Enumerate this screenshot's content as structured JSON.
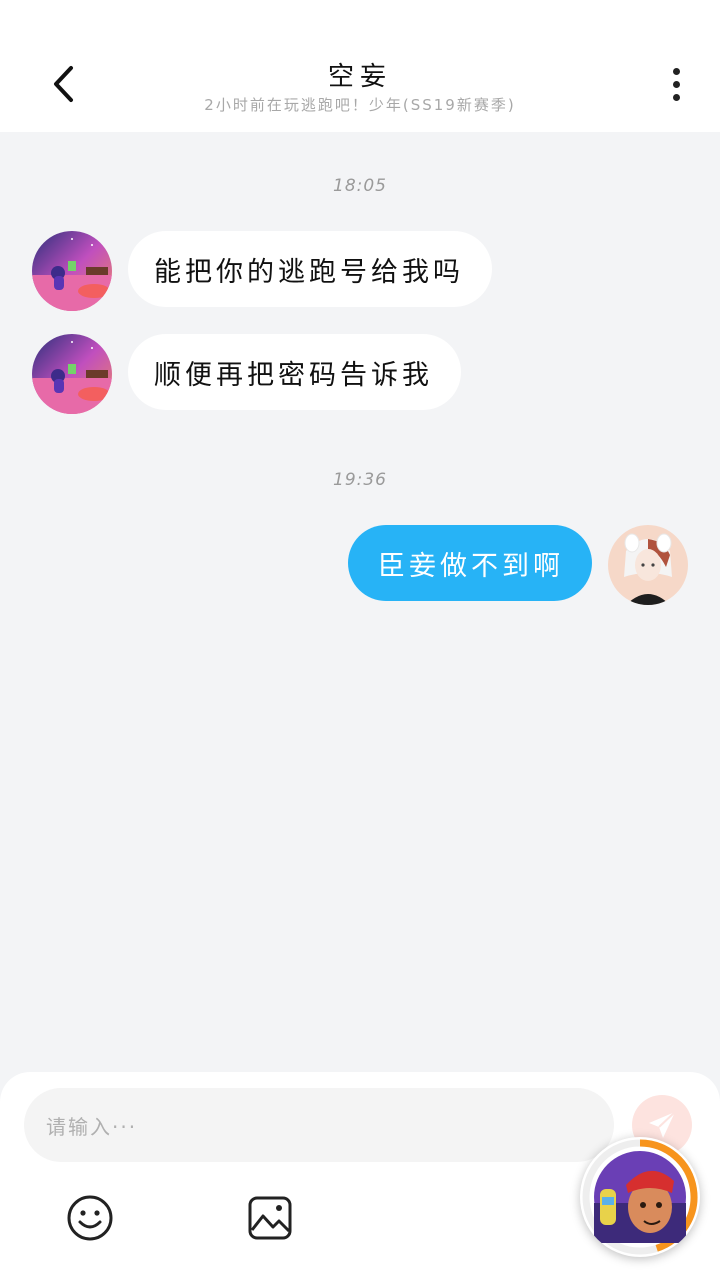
{
  "header": {
    "back_icon": "chevron-left-icon",
    "title": "空妄",
    "subtitle": "2小时前在玩逃跑吧！少年(SS19新赛季)",
    "more_icon": "more-vertical-icon"
  },
  "conversation": {
    "groups": [
      {
        "time": "18:05",
        "messages": [
          {
            "side": "incoming",
            "text": "能把你的逃跑号给我吗"
          },
          {
            "side": "incoming",
            "text": "顺便再把密码告诉我"
          }
        ]
      },
      {
        "time": "19:36",
        "messages": [
          {
            "side": "outgoing",
            "text": "臣妾做不到啊"
          }
        ]
      }
    ]
  },
  "composer": {
    "placeholder": "请输入···",
    "send_icon": "send-icon",
    "emoji_icon": "emoji-icon",
    "image_icon": "image-icon"
  },
  "floating_widget": {
    "icon": "game-avatar-icon",
    "progress": 0.45
  },
  "colors": {
    "outgoing_bubble": "#27b3f6",
    "incoming_bubble": "#ffffff",
    "background": "#f3f4f6",
    "send_button": "#fde3df",
    "ring": "#f7941d"
  }
}
